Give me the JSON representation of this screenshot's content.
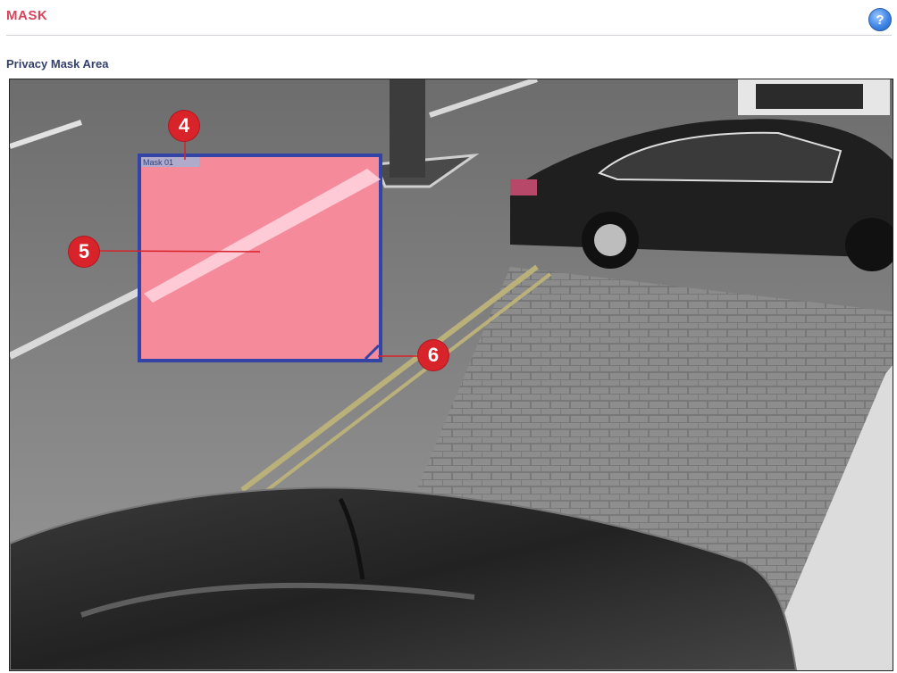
{
  "header": {
    "title": "MASK",
    "help_icon": "question-icon"
  },
  "section": {
    "title": "Privacy Mask Area"
  },
  "mask": {
    "label": "Mask 01",
    "fill_color": "#f48a9a",
    "border_color": "#3344a6"
  },
  "callouts": [
    "4",
    "5",
    "6"
  ]
}
